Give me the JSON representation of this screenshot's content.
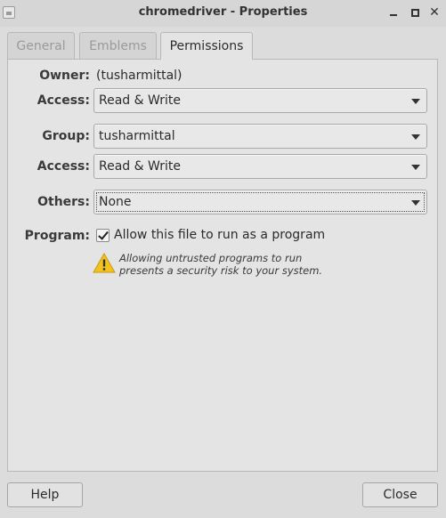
{
  "window": {
    "title": "chromedriver - Properties"
  },
  "tabs": [
    {
      "label": "General",
      "active": false
    },
    {
      "label": "Emblems",
      "active": false
    },
    {
      "label": "Permissions",
      "active": true
    }
  ],
  "permissions": {
    "owner_label": "Owner:",
    "owner_value": "(tusharmittal)",
    "owner_access_label": "Access:",
    "owner_access_value": "Read & Write",
    "group_label": "Group:",
    "group_value": "tusharmittal",
    "group_access_label": "Access:",
    "group_access_value": "Read & Write",
    "others_label": "Others:",
    "others_value": "None",
    "program_label": "Program:",
    "program_checkbox_label": "Allow this file to run as a program",
    "program_checked": true,
    "warning_line1": "Allowing untrusted programs to run",
    "warning_line2": "presents a security risk to your system."
  },
  "buttons": {
    "help": "Help",
    "close": "Close"
  },
  "colors": {
    "warning": "#f3c21f",
    "background": "#dcdcdc",
    "panel": "#e4e4e4"
  }
}
